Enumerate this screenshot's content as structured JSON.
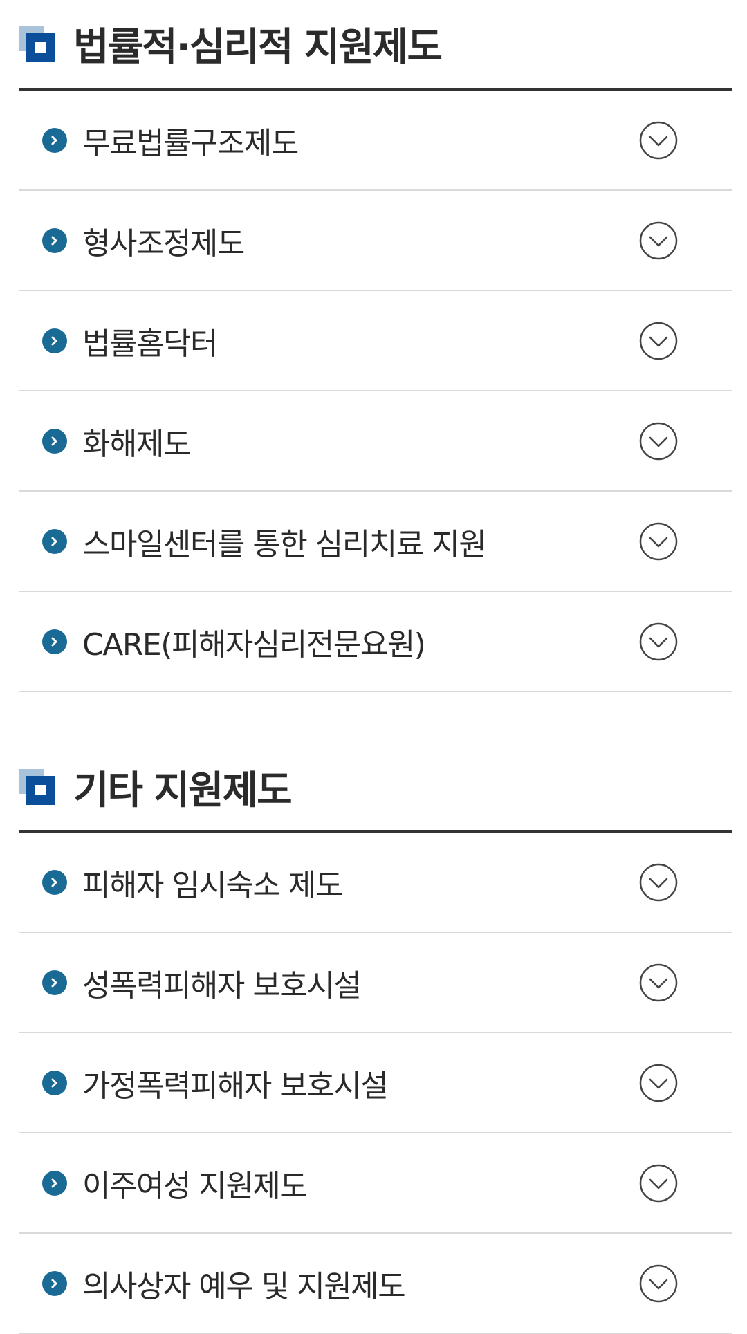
{
  "sections": [
    {
      "title": "법률적·심리적 지원제도",
      "items": [
        {
          "label": "무료법률구조제도"
        },
        {
          "label": "형사조정제도"
        },
        {
          "label": "법률홈닥터"
        },
        {
          "label": "화해제도"
        },
        {
          "label": "스마일센터를 통한 심리치료 지원"
        },
        {
          "label": "CARE(피해자심리전문요원)"
        }
      ]
    },
    {
      "title": "기타 지원제도",
      "items": [
        {
          "label": "피해자 임시숙소 제도"
        },
        {
          "label": "성폭력피해자 보호시설"
        },
        {
          "label": "가정폭력피해자 보호시설"
        },
        {
          "label": "이주여성 지원제도"
        },
        {
          "label": "의사상자 예우 및 지원제도"
        }
      ]
    }
  ],
  "icons": {
    "title": "square-logo-icon",
    "bullet": "chevron-right-circle-icon",
    "expand": "chevron-down-circle-icon"
  },
  "colors": {
    "accent": "#0b4f9b",
    "accent_light": "#a9c4da",
    "bullet": "#1a6a96",
    "divider": "#d9d9d9",
    "header_rule": "#333333"
  }
}
